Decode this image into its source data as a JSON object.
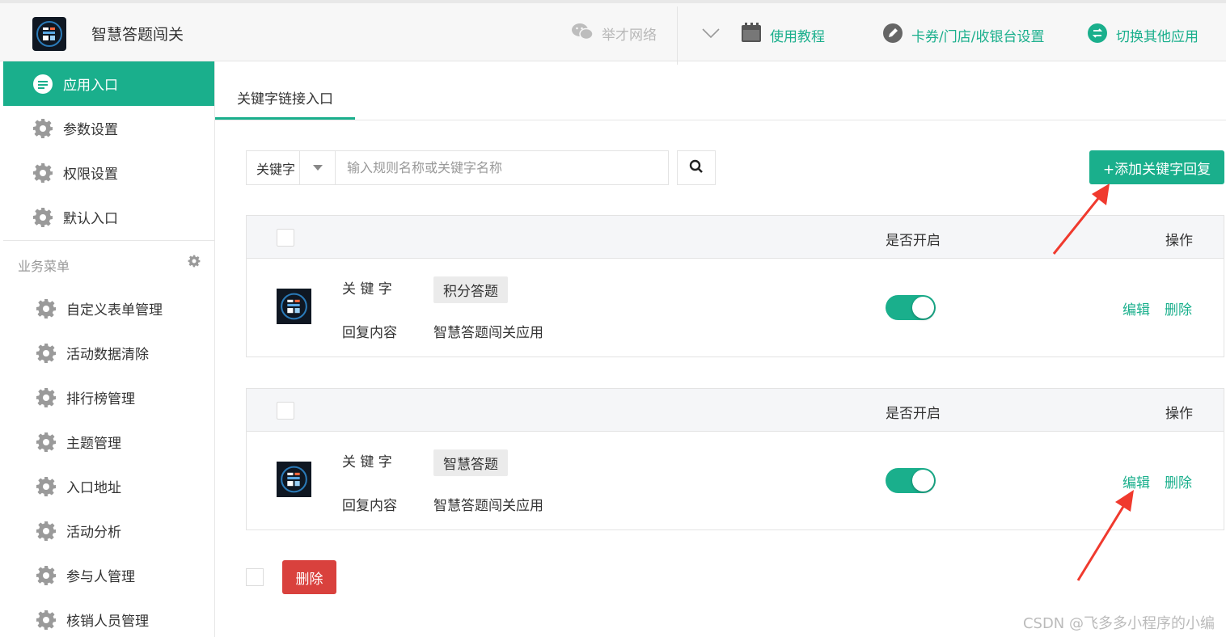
{
  "header": {
    "app_title": "智慧答题闯关",
    "company": "举才网络",
    "tutorial": "使用教程",
    "settings": "卡券/门店/收银台设置",
    "switch_app": "切换其他应用"
  },
  "sidebar": {
    "items": [
      {
        "label": "应用入口",
        "icon": "chat-icon",
        "active": true
      },
      {
        "label": "参数设置",
        "icon": "gear-icon"
      },
      {
        "label": "权限设置",
        "icon": "gear-icon"
      },
      {
        "label": "默认入口",
        "icon": "gear-icon"
      }
    ],
    "section_title": "业务菜单",
    "business": [
      {
        "label": "自定义表单管理"
      },
      {
        "label": "活动数据清除"
      },
      {
        "label": "排行榜管理"
      },
      {
        "label": "主题管理"
      },
      {
        "label": "入口地址"
      },
      {
        "label": "活动分析"
      },
      {
        "label": "参与人管理"
      },
      {
        "label": "核销人员管理"
      }
    ]
  },
  "main": {
    "tab": "关键字链接入口",
    "search": {
      "type": "关键字",
      "placeholder": "输入规则名称或关键字名称"
    },
    "add_button": "+添加关键字回复",
    "columns": {
      "open": "是否开启",
      "op": "操作"
    },
    "rows": [
      {
        "keyword_label": "关 键 字",
        "keyword": "积分答题",
        "reply_label": "回复内容",
        "reply": "智慧答题闯关应用",
        "enabled": true,
        "edit": "编辑",
        "delete": "删除"
      },
      {
        "keyword_label": "关 键 字",
        "keyword": "智慧答题",
        "reply_label": "回复内容",
        "reply": "智慧答题闯关应用",
        "enabled": true,
        "edit": "编辑",
        "delete": "删除"
      }
    ],
    "bulk_delete": "删除"
  },
  "watermark": "CSDN @飞多多小程序的小编",
  "colors": {
    "accent": "#1aaf8c",
    "danger": "#d9413d",
    "arrow": "#f03a2e"
  }
}
